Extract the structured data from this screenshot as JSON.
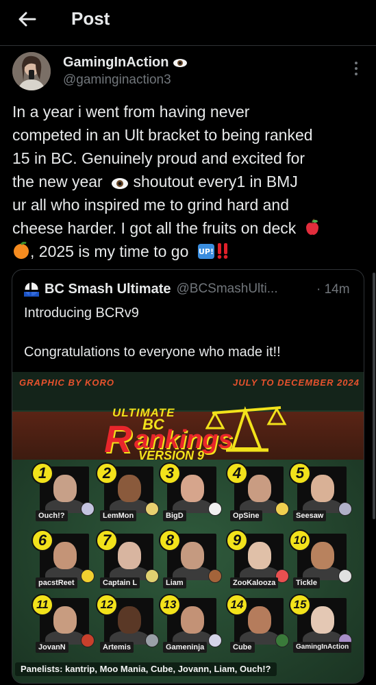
{
  "header": {
    "title": "Post"
  },
  "post": {
    "author_name": "GamingInAction",
    "author_handle": "@gaminginaction3",
    "lines": [
      "In a year i went from having never",
      "competed in an Ult bracket to being ranked",
      "15 in BC. Genuinely proud and excited for",
      "the new year",
      " shoutout every1 in BMJ",
      "ur all who inspired me to grind hard and",
      "cheese harder. I got all the fruits on deck",
      ", 2025 is my time to go"
    ],
    "emoji_names": [
      "eye-emoji",
      "red-apple-emoji",
      "tangerine-emoji",
      "up-button-emoji",
      "double-exclamation-emoji"
    ]
  },
  "quote": {
    "name": "BC Smash Ultimate",
    "handle": "@BCSmashUlti...",
    "time": "· 14m",
    "text1": "Introducing BCRv9",
    "text2": "Congratulations to everyone who made it!!"
  },
  "graphic": {
    "credit": "GRAPHIC BY KORO",
    "date_range": "JULY TO DECEMBER 2024",
    "title_ultimate": "ULTIMATE",
    "title_bc": "BC",
    "title_r": "R",
    "title_ankings": "ankings",
    "title_version": "VERSION 9",
    "rankings": [
      {
        "rank": "1",
        "name": "Ouch!?"
      },
      {
        "rank": "2",
        "name": "LemMon"
      },
      {
        "rank": "3",
        "name": "BigD"
      },
      {
        "rank": "4",
        "name": "OpSine"
      },
      {
        "rank": "5",
        "name": "Seesaw"
      },
      {
        "rank": "6",
        "name": "pacstReet"
      },
      {
        "rank": "7",
        "name": "Captain L"
      },
      {
        "rank": "8",
        "name": "Liam"
      },
      {
        "rank": "9",
        "name": "ZooKalooza"
      },
      {
        "rank": "10",
        "name": "Tickle"
      },
      {
        "rank": "11",
        "name": "JovanN"
      },
      {
        "rank": "12",
        "name": "Artemis"
      },
      {
        "rank": "13",
        "name": "Gameninja"
      },
      {
        "rank": "14",
        "name": "Cube"
      },
      {
        "rank": "15",
        "name": "GamingInAction"
      }
    ],
    "panelists": "Panelists: kantrip, Moo Mania, Cube, Jovann, Liam, Ouch!?"
  },
  "colors": {
    "background": "#000000",
    "text_primary": "#e7e9ea",
    "text_secondary": "#71767b",
    "graphic_accent_red": "#e8262b",
    "graphic_accent_yellow": "#f2e21b"
  }
}
